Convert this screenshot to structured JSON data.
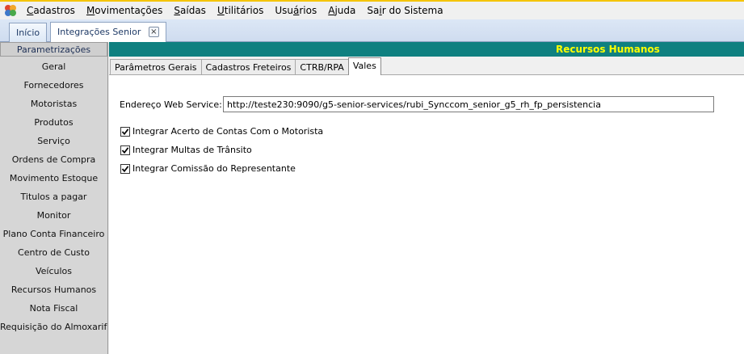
{
  "menu": {
    "items": [
      {
        "pre": "",
        "u": "C",
        "post": "adastros"
      },
      {
        "pre": "",
        "u": "M",
        "post": "ovimentações"
      },
      {
        "pre": "",
        "u": "S",
        "post": "aídas"
      },
      {
        "pre": "",
        "u": "U",
        "post": "tilitários"
      },
      {
        "pre": "Usu",
        "u": "á",
        "post": "rios"
      },
      {
        "pre": "",
        "u": "A",
        "post": "juda"
      },
      {
        "pre": "Sa",
        "u": "i",
        "post": "r do Sistema"
      }
    ]
  },
  "tabs": {
    "inicio": "Início",
    "integracoes": "Integrações Senior",
    "close": "×"
  },
  "sidebar": {
    "header": "Parametrizações",
    "items": [
      "Geral",
      "Fornecedores",
      "Motoristas",
      "Produtos",
      "Serviço",
      "Ordens de Compra",
      "Movimento Estoque",
      "Titulos a pagar",
      "Monitor",
      "Plano Conta Financeiro",
      "Centro de Custo",
      "Veículos",
      "Recursos Humanos",
      "Nota Fiscal",
      "Requisição do Almoxarifado"
    ]
  },
  "main": {
    "section_title": "Recursos Humanos",
    "page_tabs": [
      "Parâmetros Gerais",
      "Cadastros Freteiros",
      "CTRB/RPA",
      "Vales"
    ],
    "webservice": {
      "label": "Endereço Web Service:",
      "value": "http://teste230:9090/g5-senior-services/rubi_Synccom_senior_g5_rh_fp_persistencia"
    },
    "checks": [
      {
        "label": "Integrar Acerto de Contas Com o Motorista",
        "checked": true
      },
      {
        "label": "Integrar Multas de Trânsito",
        "checked": true
      },
      {
        "label": "Integrar Comissão do Representante",
        "checked": true
      }
    ]
  },
  "colors": {
    "section_bar": "#0f8080",
    "section_text": "#ffff00",
    "sidebar_bg": "#d6d6d6",
    "tab_strip": "#dce7f6"
  }
}
